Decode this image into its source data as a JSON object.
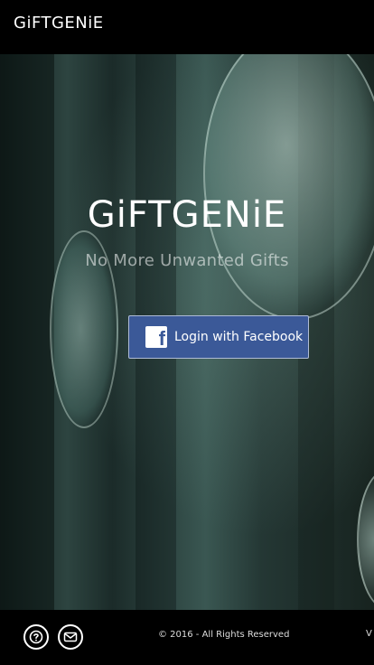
{
  "header": {
    "brand": "GiFTGENiE"
  },
  "hero": {
    "title": "GiFTGENiE",
    "tagline": "No More Unwanted Gifts",
    "login_button_label": "Login with Facebook",
    "login_button_color": "#3b5998",
    "facebook_icon": "facebook-icon",
    "facebook_glyph": "f"
  },
  "footer": {
    "help_icon": "help-icon",
    "mail_icon": "mail-icon",
    "copyright": "© 2016 - All Rights Reserved",
    "cut_text": "V"
  }
}
